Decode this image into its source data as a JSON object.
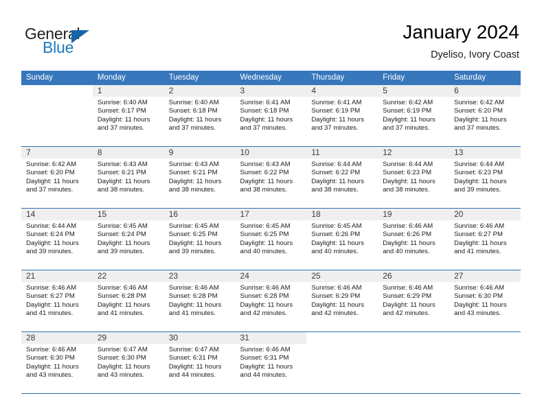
{
  "brand": {
    "word_general": "General",
    "word_blue": "Blue",
    "triangle_color": "#1565a8",
    "blue_color": "#1c7ac0"
  },
  "header": {
    "title": "January 2024",
    "subtitle": "Dyeliso, Ivory Coast"
  },
  "theme": {
    "header_blue": "#3777bc",
    "row_divider_blue": "#2f6fb0",
    "daynum_band_gray": "#efefef"
  },
  "weekdays": [
    "Sunday",
    "Monday",
    "Tuesday",
    "Wednesday",
    "Thursday",
    "Friday",
    "Saturday"
  ],
  "weeks": [
    [
      {
        "day": "",
        "sunrise": "",
        "sunset": "",
        "daylight_line1": "",
        "daylight_line2": ""
      },
      {
        "day": "1",
        "sunrise": "Sunrise: 6:40 AM",
        "sunset": "Sunset: 6:17 PM",
        "daylight_line1": "Daylight: 11 hours",
        "daylight_line2": "and 37 minutes."
      },
      {
        "day": "2",
        "sunrise": "Sunrise: 6:40 AM",
        "sunset": "Sunset: 6:18 PM",
        "daylight_line1": "Daylight: 11 hours",
        "daylight_line2": "and 37 minutes."
      },
      {
        "day": "3",
        "sunrise": "Sunrise: 6:41 AM",
        "sunset": "Sunset: 6:18 PM",
        "daylight_line1": "Daylight: 11 hours",
        "daylight_line2": "and 37 minutes."
      },
      {
        "day": "4",
        "sunrise": "Sunrise: 6:41 AM",
        "sunset": "Sunset: 6:19 PM",
        "daylight_line1": "Daylight: 11 hours",
        "daylight_line2": "and 37 minutes."
      },
      {
        "day": "5",
        "sunrise": "Sunrise: 6:42 AM",
        "sunset": "Sunset: 6:19 PM",
        "daylight_line1": "Daylight: 11 hours",
        "daylight_line2": "and 37 minutes."
      },
      {
        "day": "6",
        "sunrise": "Sunrise: 6:42 AM",
        "sunset": "Sunset: 6:20 PM",
        "daylight_line1": "Daylight: 11 hours",
        "daylight_line2": "and 37 minutes."
      }
    ],
    [
      {
        "day": "7",
        "sunrise": "Sunrise: 6:42 AM",
        "sunset": "Sunset: 6:20 PM",
        "daylight_line1": "Daylight: 11 hours",
        "daylight_line2": "and 37 minutes."
      },
      {
        "day": "8",
        "sunrise": "Sunrise: 6:43 AM",
        "sunset": "Sunset: 6:21 PM",
        "daylight_line1": "Daylight: 11 hours",
        "daylight_line2": "and 38 minutes."
      },
      {
        "day": "9",
        "sunrise": "Sunrise: 6:43 AM",
        "sunset": "Sunset: 6:21 PM",
        "daylight_line1": "Daylight: 11 hours",
        "daylight_line2": "and 38 minutes."
      },
      {
        "day": "10",
        "sunrise": "Sunrise: 6:43 AM",
        "sunset": "Sunset: 6:22 PM",
        "daylight_line1": "Daylight: 11 hours",
        "daylight_line2": "and 38 minutes."
      },
      {
        "day": "11",
        "sunrise": "Sunrise: 6:44 AM",
        "sunset": "Sunset: 6:22 PM",
        "daylight_line1": "Daylight: 11 hours",
        "daylight_line2": "and 38 minutes."
      },
      {
        "day": "12",
        "sunrise": "Sunrise: 6:44 AM",
        "sunset": "Sunset: 6:23 PM",
        "daylight_line1": "Daylight: 11 hours",
        "daylight_line2": "and 38 minutes."
      },
      {
        "day": "13",
        "sunrise": "Sunrise: 6:44 AM",
        "sunset": "Sunset: 6:23 PM",
        "daylight_line1": "Daylight: 11 hours",
        "daylight_line2": "and 39 minutes."
      }
    ],
    [
      {
        "day": "14",
        "sunrise": "Sunrise: 6:44 AM",
        "sunset": "Sunset: 6:24 PM",
        "daylight_line1": "Daylight: 11 hours",
        "daylight_line2": "and 39 minutes."
      },
      {
        "day": "15",
        "sunrise": "Sunrise: 6:45 AM",
        "sunset": "Sunset: 6:24 PM",
        "daylight_line1": "Daylight: 11 hours",
        "daylight_line2": "and 39 minutes."
      },
      {
        "day": "16",
        "sunrise": "Sunrise: 6:45 AM",
        "sunset": "Sunset: 6:25 PM",
        "daylight_line1": "Daylight: 11 hours",
        "daylight_line2": "and 39 minutes."
      },
      {
        "day": "17",
        "sunrise": "Sunrise: 6:45 AM",
        "sunset": "Sunset: 6:25 PM",
        "daylight_line1": "Daylight: 11 hours",
        "daylight_line2": "and 40 minutes."
      },
      {
        "day": "18",
        "sunrise": "Sunrise: 6:45 AM",
        "sunset": "Sunset: 6:26 PM",
        "daylight_line1": "Daylight: 11 hours",
        "daylight_line2": "and 40 minutes."
      },
      {
        "day": "19",
        "sunrise": "Sunrise: 6:46 AM",
        "sunset": "Sunset: 6:26 PM",
        "daylight_line1": "Daylight: 11 hours",
        "daylight_line2": "and 40 minutes."
      },
      {
        "day": "20",
        "sunrise": "Sunrise: 6:46 AM",
        "sunset": "Sunset: 6:27 PM",
        "daylight_line1": "Daylight: 11 hours",
        "daylight_line2": "and 41 minutes."
      }
    ],
    [
      {
        "day": "21",
        "sunrise": "Sunrise: 6:46 AM",
        "sunset": "Sunset: 6:27 PM",
        "daylight_line1": "Daylight: 11 hours",
        "daylight_line2": "and 41 minutes."
      },
      {
        "day": "22",
        "sunrise": "Sunrise: 6:46 AM",
        "sunset": "Sunset: 6:28 PM",
        "daylight_line1": "Daylight: 11 hours",
        "daylight_line2": "and 41 minutes."
      },
      {
        "day": "23",
        "sunrise": "Sunrise: 6:46 AM",
        "sunset": "Sunset: 6:28 PM",
        "daylight_line1": "Daylight: 11 hours",
        "daylight_line2": "and 41 minutes."
      },
      {
        "day": "24",
        "sunrise": "Sunrise: 6:46 AM",
        "sunset": "Sunset: 6:28 PM",
        "daylight_line1": "Daylight: 11 hours",
        "daylight_line2": "and 42 minutes."
      },
      {
        "day": "25",
        "sunrise": "Sunrise: 6:46 AM",
        "sunset": "Sunset: 6:29 PM",
        "daylight_line1": "Daylight: 11 hours",
        "daylight_line2": "and 42 minutes."
      },
      {
        "day": "26",
        "sunrise": "Sunrise: 6:46 AM",
        "sunset": "Sunset: 6:29 PM",
        "daylight_line1": "Daylight: 11 hours",
        "daylight_line2": "and 42 minutes."
      },
      {
        "day": "27",
        "sunrise": "Sunrise: 6:46 AM",
        "sunset": "Sunset: 6:30 PM",
        "daylight_line1": "Daylight: 11 hours",
        "daylight_line2": "and 43 minutes."
      }
    ],
    [
      {
        "day": "28",
        "sunrise": "Sunrise: 6:46 AM",
        "sunset": "Sunset: 6:30 PM",
        "daylight_line1": "Daylight: 11 hours",
        "daylight_line2": "and 43 minutes."
      },
      {
        "day": "29",
        "sunrise": "Sunrise: 6:47 AM",
        "sunset": "Sunset: 6:30 PM",
        "daylight_line1": "Daylight: 11 hours",
        "daylight_line2": "and 43 minutes."
      },
      {
        "day": "30",
        "sunrise": "Sunrise: 6:47 AM",
        "sunset": "Sunset: 6:31 PM",
        "daylight_line1": "Daylight: 11 hours",
        "daylight_line2": "and 44 minutes."
      },
      {
        "day": "31",
        "sunrise": "Sunrise: 6:46 AM",
        "sunset": "Sunset: 6:31 PM",
        "daylight_line1": "Daylight: 11 hours",
        "daylight_line2": "and 44 minutes."
      },
      {
        "day": "",
        "sunrise": "",
        "sunset": "",
        "daylight_line1": "",
        "daylight_line2": ""
      },
      {
        "day": "",
        "sunrise": "",
        "sunset": "",
        "daylight_line1": "",
        "daylight_line2": ""
      },
      {
        "day": "",
        "sunrise": "",
        "sunset": "",
        "daylight_line1": "",
        "daylight_line2": ""
      }
    ]
  ]
}
